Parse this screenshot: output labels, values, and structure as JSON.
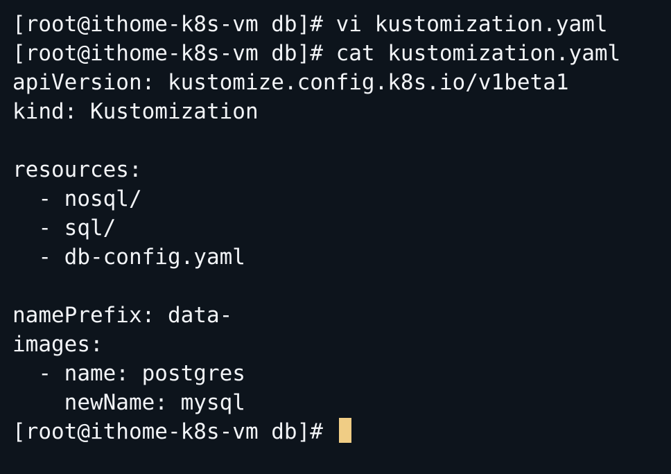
{
  "terminal": {
    "lines": [
      "[root@ithome-k8s-vm db]# vi kustomization.yaml",
      "[root@ithome-k8s-vm db]# cat kustomization.yaml",
      "apiVersion: kustomize.config.k8s.io/v1beta1",
      "kind: Kustomization",
      "",
      "resources:",
      "  - nosql/",
      "  - sql/",
      "  - db-config.yaml",
      "",
      "namePrefix: data-",
      "images:",
      "  - name: postgres",
      "    newName: mysql"
    ],
    "prompt": "[root@ithome-k8s-vm db]# "
  },
  "colors": {
    "background": "#0d141c",
    "text": "#f2f4f7",
    "cursor": "#f0cd85"
  }
}
